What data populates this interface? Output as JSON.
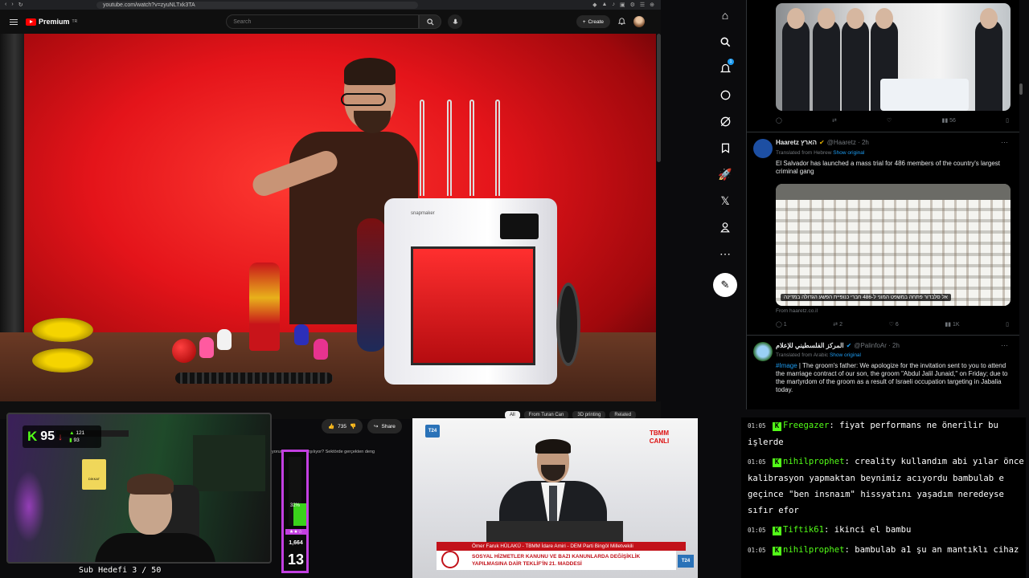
{
  "browser": {
    "url": "youtube.com/watch?v=zyuNLTxk3TA"
  },
  "youtube": {
    "logo_text": "Premium",
    "logo_sup": "TR",
    "search_placeholder": "Search",
    "create_label": "Create",
    "like_count": "735",
    "share_label": "Share",
    "chips": [
      "All",
      "From Turan Can",
      "3D printing",
      "Related"
    ],
    "description_snippet": "yorum ne kadar karşılıyor? Sektörde gerçekten deng",
    "video_brand": "snapmaker"
  },
  "stream_overlay": {
    "kick_logo": "K",
    "viewer_count": "95",
    "stat_top": "121",
    "stat_bottom": "93",
    "warning_text": "DİKKAT",
    "sub_goal": "Sub Hedefi 3 / 50",
    "meter_percent_label": "32%",
    "meter_fill_fraction": 0.32,
    "meter_stars": "★★☆",
    "meter_value": "1,664",
    "meter_big": "13"
  },
  "tv": {
    "logo": "T24",
    "tbmm_logo_line1": "TBMM",
    "tbmm_logo_line2": "CANLI",
    "name_line": "Ömer Faruk HÜLAKÜ - TBMM İdare Amiri - DEM Parti Bingöl Milletvekili",
    "title_line1": "SOSYAL HİZMETLER KANUNU VE BAZI KANUNLARDA DEĞİŞİKLİK",
    "title_line2": "YAPILMASINA DAİR TEKLİF'İN 21. MADDESİ",
    "corner_logo": "T24"
  },
  "x_nav": {
    "notification_badge": "1",
    "icons": [
      "home-icon",
      "search-icon",
      "bell-icon",
      "messages-icon",
      "grok-icon",
      "bookmark-icon",
      "jobs-icon",
      "x-logo-icon",
      "profile-icon",
      "more-icon"
    ]
  },
  "tweets": [
    {
      "views": "56"
    },
    {
      "name": "Haaretz הארץ",
      "handle": "@Haaretz · 2h",
      "translated": "Translated from Hebrew",
      "show_original": "Show original",
      "text": "El Salvador has launched a mass trial for 486 members of the country's largest criminal gang",
      "image_caption": "אל סלבדור פתחה במשפט המוני ל-486 חברי כנופיית הפשע הגדולה במדינה",
      "from": "From haaretz.co.il",
      "replies": "1",
      "reposts": "2",
      "likes": "6",
      "views": "1K"
    },
    {
      "name": "المركز الفلسطيني للإعلام",
      "handle": "@PalinfoAr · 2h",
      "translated": "Translated from Arabic",
      "show_original": "Show original",
      "tag": "#Image",
      "text": " | The groom's father: We apologize for the invitation sent to you to attend the marriage contract of our son, the groom \"Abdul Jalil Junaid,\" on Friday; due to the martyrdom of the groom as a result of Israeli occupation targeting in Jabalia today."
    }
  ],
  "chat": [
    {
      "time": "01:05",
      "user": "Freegazer",
      "text": "fiyat performans ne önerilir bu işlerde"
    },
    {
      "time": "01:05",
      "user": "nihilprophet",
      "text": "creality kullandım abi yılar önce kalibrasyon yapmaktan beynimiz acıyordu bambulab e geçince \"ben insnaım\" hissyatını yaşadım neredeyse sıfır efor"
    },
    {
      "time": "01:05",
      "user": "Tiftik61",
      "text": "ikinci el bambu"
    },
    {
      "time": "01:05",
      "user": "nihilprophet",
      "text": "bambulab a1 şu an mantıklı cihaz"
    }
  ],
  "colors": {
    "kick_green": "#53fc18",
    "youtube_red": "#ff0000",
    "x_blue": "#1d9bf0",
    "meter_purple": "#c23fe0"
  }
}
